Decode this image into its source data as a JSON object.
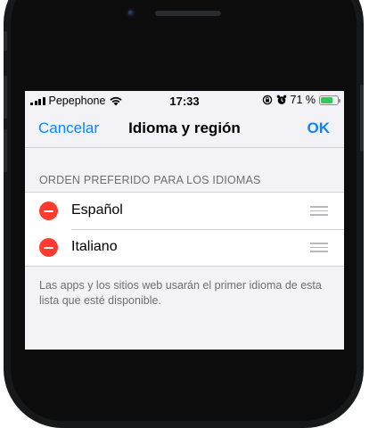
{
  "status_bar": {
    "carrier": "Pepephone",
    "time": "17:33",
    "battery_text": "71 %",
    "battery_level_percent": 71,
    "icons": [
      "signal-icon",
      "wifi-icon",
      "orientation-lock-icon",
      "alarm-icon",
      "battery-charging-icon"
    ]
  },
  "nav": {
    "cancel_label": "Cancelar",
    "title": "Idioma y región",
    "ok_label": "OK"
  },
  "section": {
    "header": "ORDEN PREFERIDO PARA LOS IDIOMAS"
  },
  "languages": [
    {
      "label": "Español"
    },
    {
      "label": "Italiano"
    }
  ],
  "footer": {
    "note": "Las apps y los sitios web usarán el primer idioma de esta lista que esté disponible."
  },
  "colors": {
    "accent": "#0a84ff",
    "delete": "#ff3b30",
    "battery": "#34c759"
  }
}
